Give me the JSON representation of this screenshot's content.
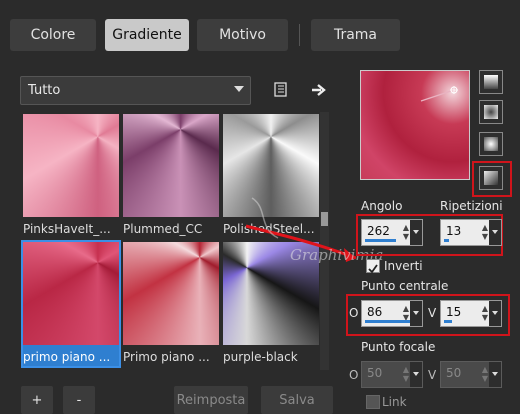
{
  "tabs": [
    {
      "label": "Colore"
    },
    {
      "label": "Gradiente",
      "active": true
    },
    {
      "label": "Motivo"
    },
    {
      "label": "Trama"
    }
  ],
  "filter": {
    "selected": "Tutto"
  },
  "gradients": [
    {
      "name": "PinksHaveIt_..."
    },
    {
      "name": "Plummed_CC"
    },
    {
      "name": "PolishedSteel..."
    },
    {
      "name": "primo piano ...",
      "selected": true
    },
    {
      "name": "Primo piano ..."
    },
    {
      "name": "purple-black"
    }
  ],
  "buttons": {
    "add": "+",
    "remove": "-",
    "reset": "Reimposta",
    "save": "Salva"
  },
  "watermark": "Graphivimia",
  "angle": {
    "label": "Angolo",
    "value": "262",
    "fraction": 0.73
  },
  "repeats": {
    "label": "Ripetizioni",
    "value": "13",
    "fraction": 0.13
  },
  "invert": {
    "label": "Inverti",
    "checked": true
  },
  "center_point": {
    "label": "Punto centrale",
    "h_label": "O",
    "h_value": "86",
    "h_fraction": 0.86,
    "v_label": "V",
    "v_value": "15",
    "v_fraction": 0.15
  },
  "focal_point": {
    "label": "Punto focale",
    "h_label": "O",
    "h_value": "50",
    "v_label": "V",
    "v_value": "50"
  },
  "link": {
    "label": "Link"
  },
  "colors": {
    "accent": "#2f7fd0",
    "highlight": "#d0141b"
  }
}
